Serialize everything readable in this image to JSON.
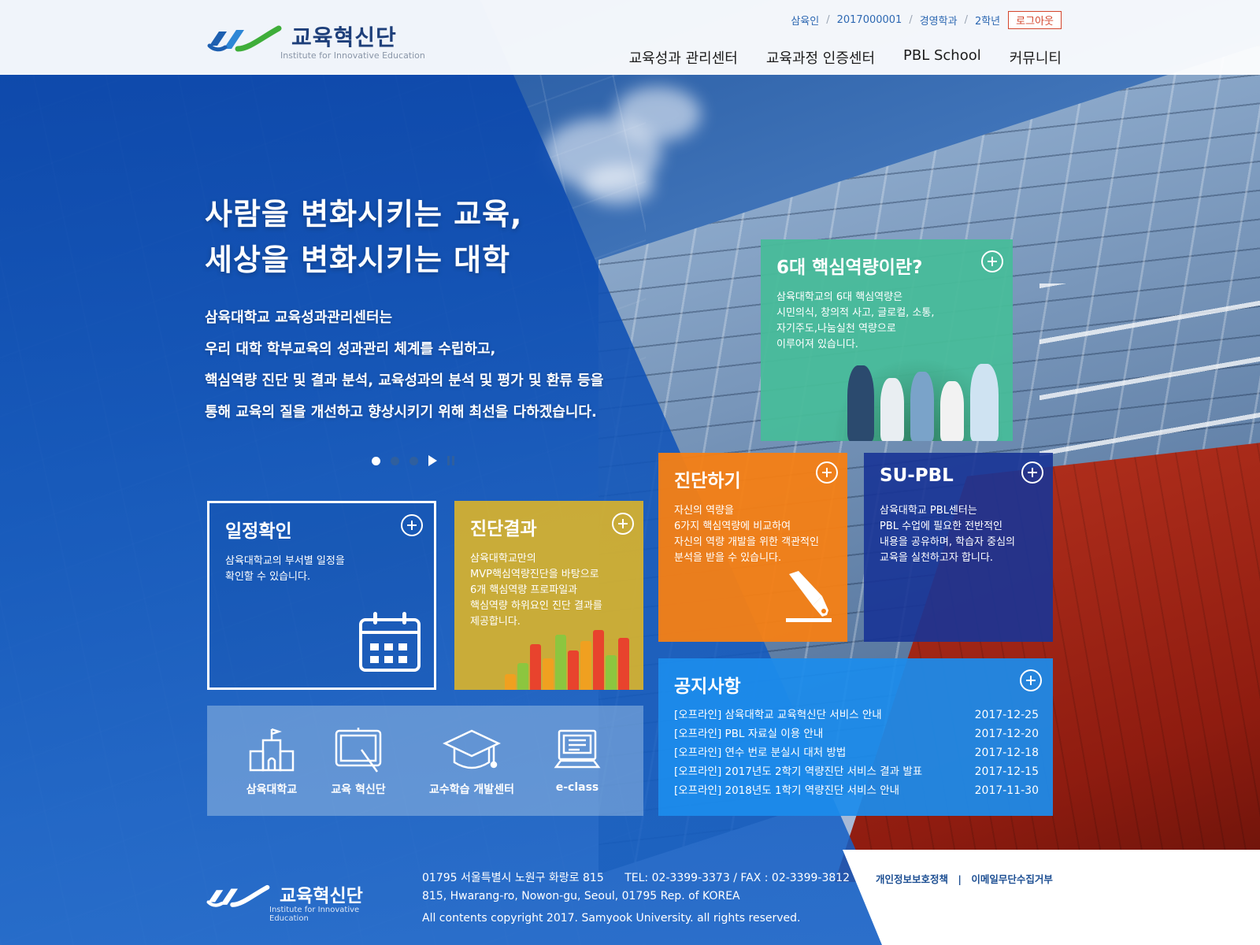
{
  "header": {
    "logo_title": "교육혁신단",
    "logo_sub": "Institute for Innovative Education",
    "user": {
      "name": "삼육인",
      "id": "2017000001",
      "dept": "경영학과",
      "grade": "2학년",
      "logout": "로그아웃",
      "separator": "/"
    },
    "nav": [
      "교육성과 관리센터",
      "교육과정 인증센터",
      "PBL School",
      "커뮤니티"
    ]
  },
  "hero": {
    "title_line1": "사람을 변화시키는 교육,",
    "title_line2": "세상을 변화시키는 대학",
    "desc": [
      "삼육대학교 교육성과관리센터는",
      "우리 대학 학부교육의 성과관리 체계를 수립하고,",
      "핵심역량 진단 및 결과 분석, 교육성과의 분석 및 평가 및 환류 등을",
      "통해 교육의 질을 개선하고 향상시키기 위해 최선을 다하겠습니다."
    ]
  },
  "slider": {
    "slide_count": 3,
    "active_index": 0
  },
  "tiles": {
    "schedule": {
      "title": "일정확인",
      "desc": [
        "삼육대학교의 부서별 일정을",
        "확인할 수 있습니다."
      ],
      "icon": "calendar-icon"
    },
    "result": {
      "title": "진단결과",
      "desc": [
        "삼육대학교만의",
        "MVP핵심역량진단을 바탕으로",
        "6개 핵심역량 프로파일과",
        "핵심역량 하위요인 진단 결과를",
        "제공합니다."
      ],
      "icon": "bar-chart-icon"
    },
    "competency": {
      "title": "6대 핵심역량이란?",
      "desc": [
        "삼육대학교의 6대 핵심역량은",
        "시민의식, 창의적 사고, 글로컬, 소통,",
        "자기주도,나눔실천 역량으로",
        "이루어져 있습니다."
      ]
    },
    "diagnose": {
      "title": "진단하기",
      "desc": [
        "자신의 역량을",
        "6가지 핵심역량에 비교하여",
        "자신의 역량 개발을 위한 객관적인",
        "분석을 받을 수 있습니다."
      ],
      "icon": "pen-icon"
    },
    "supbl": {
      "title": "SU-PBL",
      "desc": [
        "삼육대학교 PBL센터는",
        "PBL 수업에 필요한 전반적인",
        "내용을 공유하며, 학습자 중심의",
        "교육을 실천하고자 합니다."
      ]
    },
    "notice": {
      "title": "공지사항",
      "items": [
        {
          "title": "[오프라인] 삼육대학교 교육혁신단 서비스 안내",
          "date": "2017-12-25"
        },
        {
          "title": "[오프라인] PBL 자료실 이용 안내",
          "date": "2017-12-20"
        },
        {
          "title": "[오프라인] 연수 번로 분실시 대처 방법",
          "date": "2017-12-18"
        },
        {
          "title": "[오프라인] 2017년도 2학기 역량진단 서비스 결과 발표",
          "date": "2017-12-15"
        },
        {
          "title": "[오프라인] 2018년도 1학기 역량진단 서비스 안내",
          "date": "2017-11-30"
        }
      ]
    }
  },
  "quick_links": [
    {
      "label": "삼육대학교",
      "icon": "university-building-icon"
    },
    {
      "label": "교육 혁신단",
      "icon": "whiteboard-icon"
    },
    {
      "label": "교수학습 개발센터",
      "icon": "graduation-cap-icon"
    },
    {
      "label": "e-class",
      "icon": "computer-monitor-icon"
    }
  ],
  "footer": {
    "logo_title": "교육혁신단",
    "logo_sub": "Institute for Innovative Education",
    "address_kr": "01795 서울특별시 노원구 화랑로 815",
    "tel_fax": "TEL: 02-3399-3373 / FAX : 02-3399-3812",
    "address_en": "815, Hwarang-ro, Nowon-gu, Seoul, 01795 Rep. of KOREA",
    "copyright": "All contents copyright 2017. Samyook University. all rights reserved.",
    "links": [
      "개인정보보호정책",
      "이메일무단수집거부"
    ],
    "link_separator": "|"
  },
  "colors": {
    "brand_blue": "#1e3f7a",
    "tile_green": "#48bc9a",
    "tile_yellow": "#d6b22e",
    "tile_orange": "#f58014",
    "tile_navy": "#183496",
    "tile_sky": "#1c8cec",
    "logout_red": "#d4452c"
  }
}
